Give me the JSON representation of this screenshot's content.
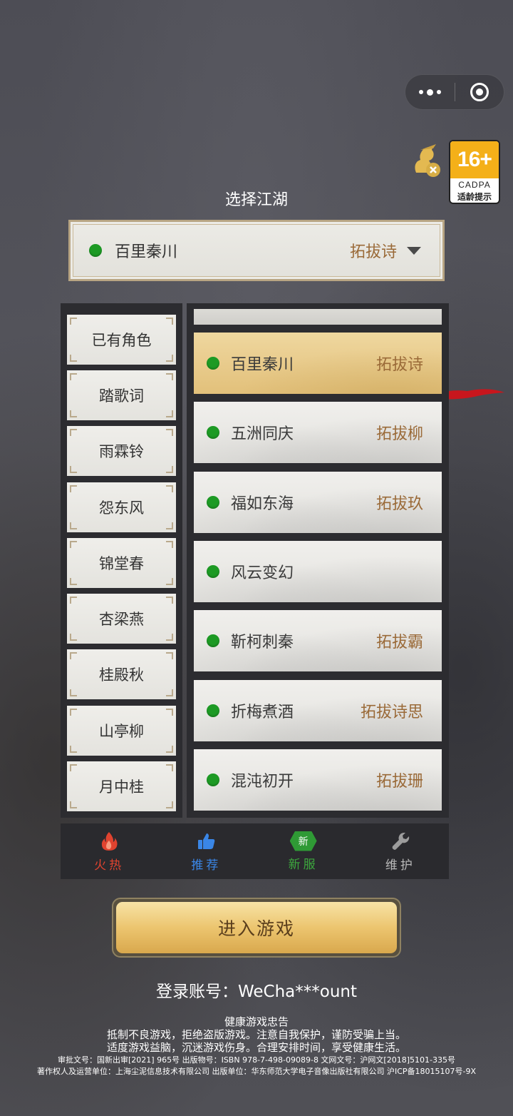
{
  "capsule": {
    "more_icon": "more-dots-icon",
    "close_icon": "target-circle-icon"
  },
  "age_badge": {
    "rating": "16+",
    "org": "CADPA",
    "caption": "适龄提示"
  },
  "heading": "选择江湖",
  "selector": {
    "server": "百里秦川",
    "role": "拓拔诗",
    "status_color": "#1d9a24"
  },
  "categories": [
    {
      "label": "已有角色"
    },
    {
      "label": "踏歌词"
    },
    {
      "label": "雨霖铃"
    },
    {
      "label": "怨东风"
    },
    {
      "label": "锦堂春"
    },
    {
      "label": "杏梁燕"
    },
    {
      "label": "桂殿秋"
    },
    {
      "label": "山亭柳"
    },
    {
      "label": "月中桂"
    }
  ],
  "servers": [
    {
      "name": "百里秦川",
      "role": "拓拔诗",
      "selected": true
    },
    {
      "name": "五洲同庆",
      "role": "拓拔柳"
    },
    {
      "name": "福如东海",
      "role": "拓拔玖"
    },
    {
      "name": "风云变幻",
      "role": ""
    },
    {
      "name": "靳柯刺秦",
      "role": "拓拔霸"
    },
    {
      "name": "折梅煮酒",
      "role": "拓拔诗思"
    },
    {
      "name": "混沌初开",
      "role": "拓拔珊"
    }
  ],
  "tabbar": {
    "hot": "火热",
    "recommend": "推荐",
    "new_badge": "新",
    "new": "新服",
    "maintenance": "维护"
  },
  "enter_button": "进入游戏",
  "account": "登录账号：WeCha***ount",
  "notice": {
    "title": "健康游戏忠告",
    "line1": "抵制不良游戏，拒绝盗版游戏。注意自我保护，谨防受骗上当。",
    "line2": "适度游戏益脑，沉迷游戏伤身。合理安排时间，享受健康生活。",
    "line3": "审批文号：国新出审[2021] 965号    出版物号：ISBN 978-7-498-09089-8    文网文号：沪网文[2018]5101-335号",
    "line4": "著作权人及运营单位：上海尘泥信息技术有限公司    出版单位：华东师范大学电子音像出版社有限公司    沪ICP备18015107号-9X"
  },
  "colors": {
    "accent_gold": "#e2c07a",
    "status_green": "#1d9a24",
    "role_brown": "#9a6a38"
  }
}
